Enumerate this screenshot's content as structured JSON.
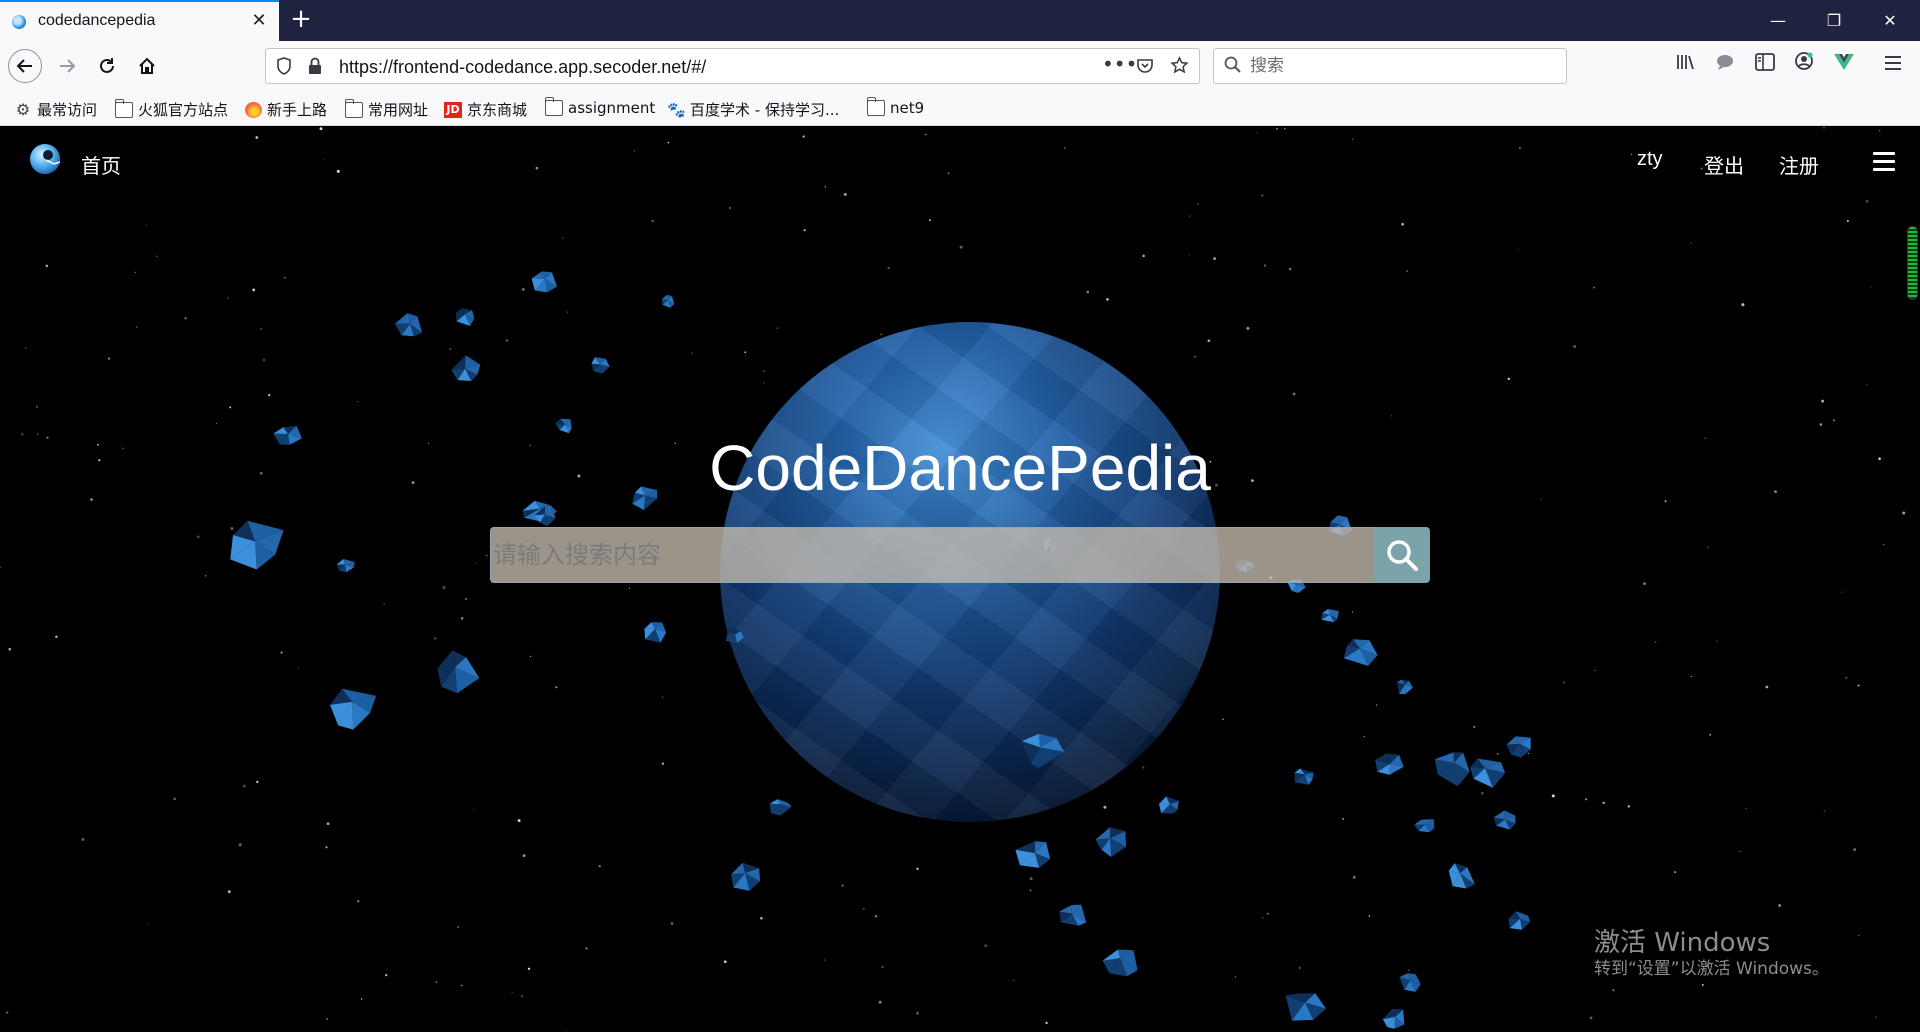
{
  "browser": {
    "tab": {
      "title": "codedancepedia",
      "close": "✕"
    },
    "new_tab": "+",
    "window_controls": {
      "minimize": "—",
      "restore": "❐",
      "close": "✕"
    },
    "address": {
      "url": "https://frontend-codedance.app.secoder.net/#/"
    },
    "search": {
      "placeholder": "搜索"
    },
    "bookmarks": [
      {
        "label": "最常访问",
        "icon": "gear-icon"
      },
      {
        "label": "火狐官方站点",
        "icon": "folder-icon"
      },
      {
        "label": "新手上路",
        "icon": "firefox-icon"
      },
      {
        "label": "常用网址",
        "icon": "folder-icon"
      },
      {
        "label": "京东商城",
        "icon": "jd-icon",
        "icon_text": "JD"
      },
      {
        "label": "assignment",
        "icon": "folder-icon"
      },
      {
        "label": "百度学术 - 保持学习...",
        "icon": "baidu-paw-icon"
      },
      {
        "label": "net9",
        "icon": "folder-icon"
      }
    ]
  },
  "site": {
    "header": {
      "home_label": "首页",
      "user": "zty",
      "logout_label": "登出",
      "register_label": "注册"
    },
    "hero": {
      "title": "CodeDancePedia",
      "search_placeholder": "请输入搜索内容"
    }
  },
  "watermark": {
    "line1": "激活 Windows",
    "line2": "转到“设置”以激活 Windows。"
  },
  "colors": {
    "tabbar": "#202340",
    "toolbar": "#f9f9fb",
    "page_bg": "#000000",
    "planet": "#2e6fb4",
    "search_button": "#7ba3aa"
  }
}
